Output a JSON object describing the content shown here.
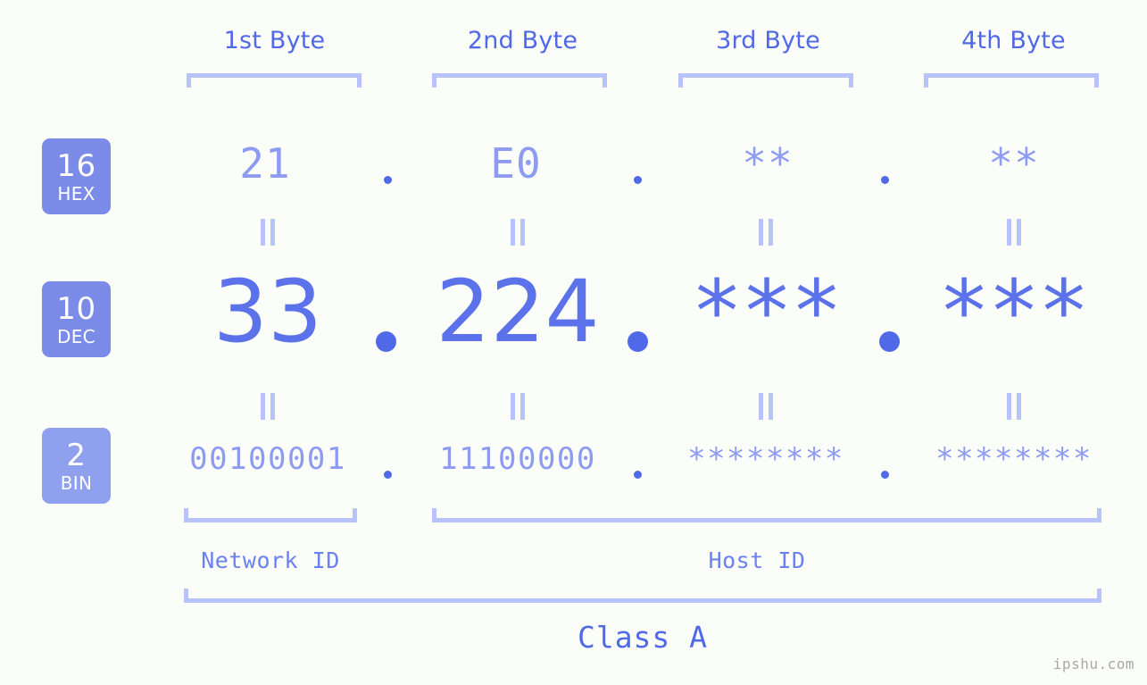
{
  "meta": {
    "watermark": "ipshu.com",
    "background_color": "#fbfdf8",
    "accent_color": "#4f69e8",
    "light_accent_color": "#b9c3fb",
    "badge_color": "#7b8ce8",
    "badge_color_light": "#8fa0ef"
  },
  "byte_headers": [
    {
      "label": "1st Byte"
    },
    {
      "label": "2nd Byte"
    },
    {
      "label": "3rd Byte"
    },
    {
      "label": "4th Byte"
    }
  ],
  "bases": [
    {
      "number": "16",
      "abbr": "HEX"
    },
    {
      "number": "10",
      "abbr": "DEC"
    },
    {
      "number": "2",
      "abbr": "BIN"
    }
  ],
  "rows": {
    "hex": {
      "base_number": "16",
      "base_abbr": "HEX",
      "values": [
        "21",
        "E0",
        "**",
        "**"
      ],
      "separator": "."
    },
    "dec": {
      "base_number": "10",
      "base_abbr": "DEC",
      "values": [
        "33",
        "224",
        "***",
        "***"
      ],
      "separator": "."
    },
    "bin": {
      "base_number": "2",
      "base_abbr": "BIN",
      "values": [
        "00100001",
        "11100000",
        "********",
        "********"
      ],
      "separator": "."
    }
  },
  "equals_symbol": "||",
  "id_sections": [
    {
      "label": "Network ID"
    },
    {
      "label": "Host ID"
    }
  ],
  "class_label": "Class A"
}
